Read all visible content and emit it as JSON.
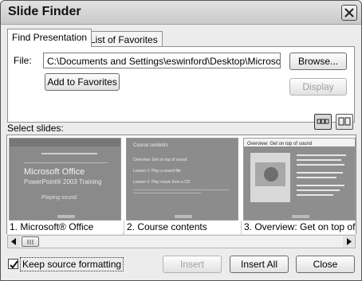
{
  "window": {
    "title": "Slide Finder"
  },
  "tabs": [
    {
      "label": "Find Presentation",
      "active": true
    },
    {
      "label": "List of Favorites",
      "active": false
    }
  ],
  "find": {
    "file_label": "File:",
    "file_path": "C:\\Documents and Settings\\eswinford\\Desktop\\MicrosoftOffic",
    "browse_label": "Browse...",
    "add_favorites_label": "Add to Favorites",
    "display_label": "Display"
  },
  "slides": {
    "section_label": "Select slides:",
    "items": [
      {
        "caption": "1. Microsoft® Office",
        "title": "Microsoft Office",
        "subtitle": "PowerPoint® 2003 Training",
        "body": "Playing sound"
      },
      {
        "caption": "2. Course contents",
        "title": "Course contents",
        "bullets": [
          "Overview: Get on top of sound",
          "Lesson 1: Play a sound file",
          "Lesson 2: Play music from a CD"
        ]
      },
      {
        "caption": "3. Overview: Get on top of",
        "title": "Overview: Get on top of sound"
      }
    ]
  },
  "options": {
    "keep_formatting_label": "Keep source formatting",
    "keep_formatting_checked": true
  },
  "buttons": {
    "insert_label": "Insert",
    "insert_all_label": "Insert All",
    "close_label": "Close"
  },
  "colors": {
    "title_bar": "#d4d4d4",
    "slide_bg": "#8f8f8f",
    "window_bg": "#ececec"
  }
}
